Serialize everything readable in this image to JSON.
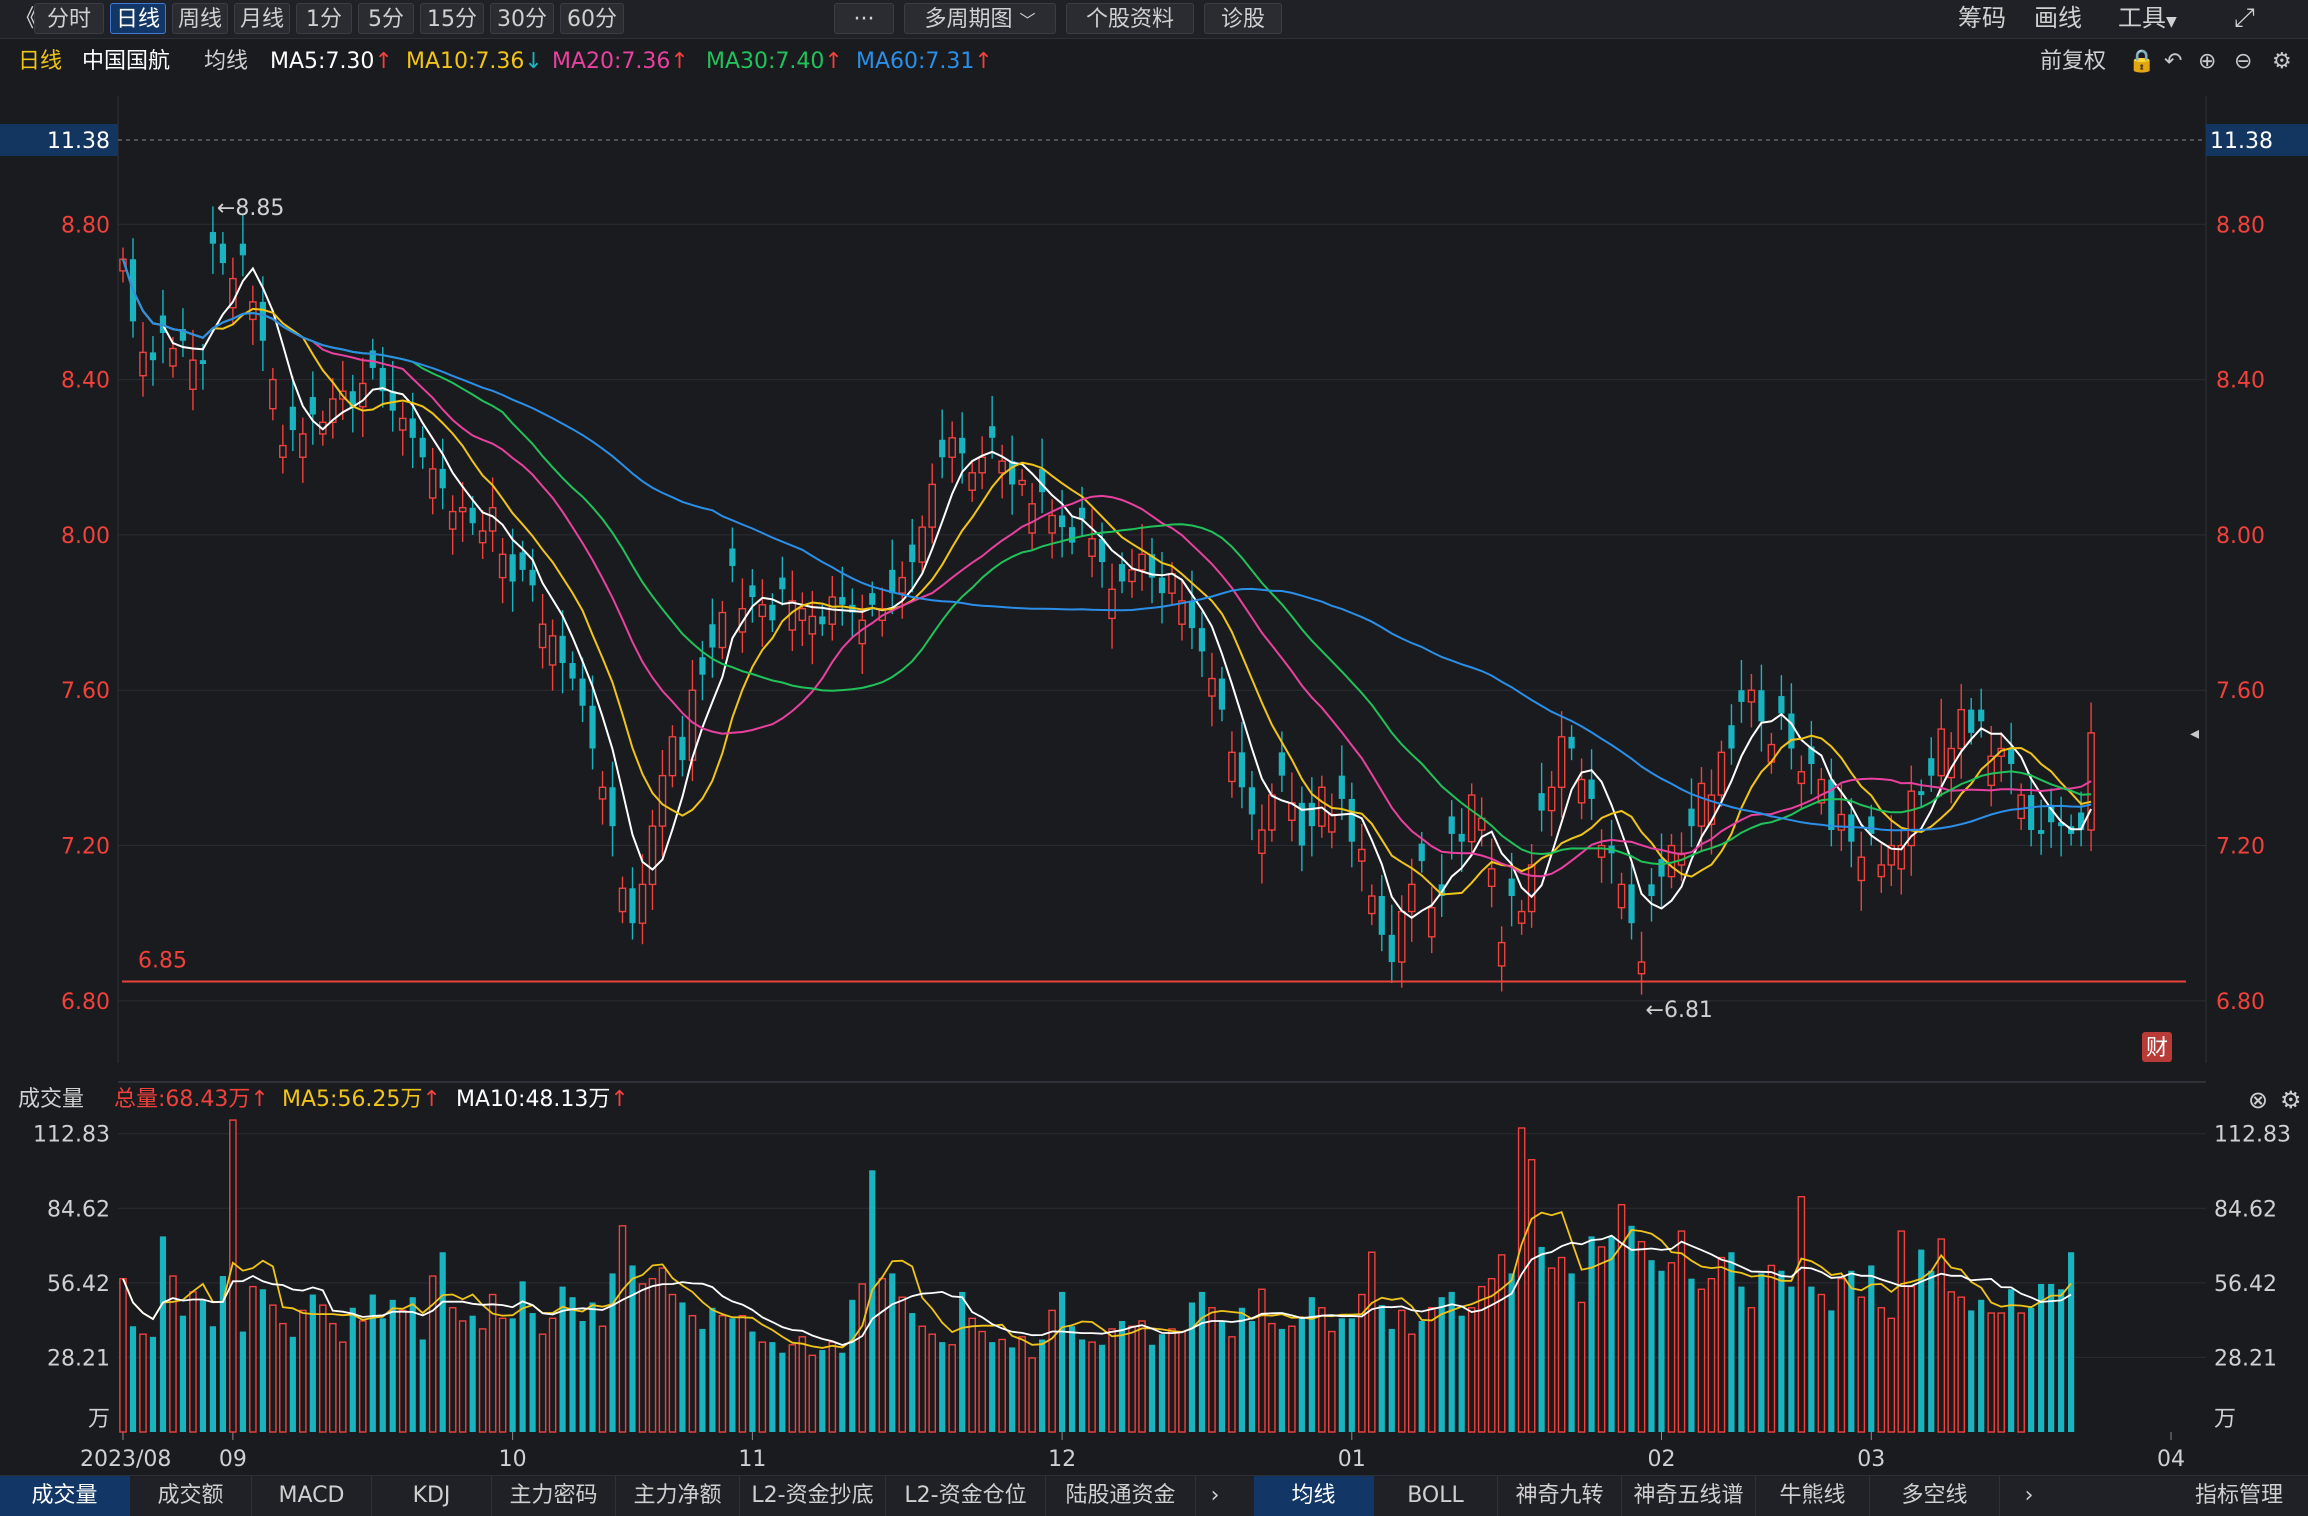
{
  "toolbar": {
    "back": "《",
    "periods": [
      "分时",
      "日线",
      "周线",
      "月线",
      "1分",
      "5分",
      "15分",
      "30分",
      "60分"
    ],
    "active_period": "日线",
    "more": "···",
    "multi": "多周期图",
    "profile": "个股资料",
    "diagnose": "诊股",
    "chips": "筹码",
    "draw": "画线",
    "tools": "工具"
  },
  "info": {
    "period": "日线",
    "stock": "中国国航",
    "ma_label": "均线",
    "ma5": "MA5:7.30",
    "ma10": "MA10:7.36",
    "ma20": "MA20:7.36",
    "ma30": "MA30:7.40",
    "ma60": "MA60:7.31",
    "adjust": "前复权"
  },
  "colors": {
    "up": "#f0413b",
    "down": "#19b4bf",
    "ma5": "#ffffff",
    "ma10": "#f0c419",
    "ma20": "#e8419f",
    "ma30": "#21c25a",
    "ma60": "#2b8fe8",
    "bg": "#1a1b1f"
  },
  "volume": {
    "label": "成交量",
    "total": "总量:68.43万",
    "ma5": "MA5:56.25万",
    "ma10": "MA10:48.13万",
    "unit": "万"
  },
  "annotations": {
    "high": "←8.85",
    "low": "←6.81",
    "support": "6.85",
    "top_price": "11.38",
    "fin_badge": "财"
  },
  "bottom_tabs": [
    "成交量",
    "成交额",
    "MACD",
    "KDJ",
    "主力密码",
    "主力净额",
    "L2-资金抄底",
    "L2-资金仓位",
    "陆股通资金"
  ],
  "bottom_tabs2": [
    "均线",
    "BOLL",
    "神奇九转",
    "神奇五线谱",
    "牛熊线",
    "多空线"
  ],
  "bottom_active": "成交量",
  "bottom_active2": "均线",
  "indicator_mgmt": "指标管理",
  "chart_data": {
    "type": "candlestick",
    "title": "中国国航 日线",
    "price_axis": {
      "ticks": [
        8.8,
        8.4,
        8.0,
        7.6,
        7.2,
        6.8
      ],
      "range": [
        6.64,
        9.12
      ],
      "top_label": 11.38
    },
    "volume_axis": {
      "ticks": [
        112.83,
        84.62,
        56.42,
        28.21
      ],
      "unit": "万",
      "range": [
        0,
        115
      ]
    },
    "x_labels": [
      "2023/08",
      "09",
      "10",
      "11",
      "12",
      "01",
      "02",
      "03",
      "04"
    ],
    "x_label_index": [
      0,
      11,
      39,
      63,
      94,
      123,
      154,
      175,
      205
    ],
    "support_line": 6.85,
    "extremes": {
      "high": 8.85,
      "low": 6.81
    },
    "ma_series": [
      "MA5",
      "MA10",
      "MA20",
      "MA30",
      "MA60"
    ],
    "ma_legend_values": [
      7.3,
      7.36,
      7.36,
      7.4,
      7.31
    ],
    "candle_count": 207,
    "closes": [
      8.71,
      8.55,
      8.47,
      8.45,
      8.52,
      8.48,
      8.5,
      8.45,
      8.44,
      8.75,
      8.7,
      8.66,
      8.72,
      8.6,
      8.5,
      8.4,
      8.23,
      8.27,
      8.26,
      8.31,
      8.29,
      8.35,
      8.37,
      8.33,
      8.39,
      8.43,
      8.37,
      8.32,
      8.3,
      8.25,
      8.2,
      8.17,
      8.12,
      8.06,
      8.07,
      8.03,
      8.01,
      8.07,
      7.95,
      7.88,
      7.91,
      7.87,
      7.77,
      7.74,
      7.67,
      7.63,
      7.56,
      7.45,
      7.35,
      7.25,
      7.09,
      7.0,
      7.1,
      7.25,
      7.38,
      7.48,
      7.42,
      7.6,
      7.64,
      7.71,
      7.8,
      7.92,
      7.81,
      7.84,
      7.82,
      7.78,
      7.86,
      7.83,
      7.81,
      7.79,
      7.77,
      7.84,
      7.82,
      7.8,
      7.78,
      7.82,
      7.81,
      7.85,
      7.89,
      7.93,
      8.02,
      8.13,
      8.2,
      8.25,
      8.21,
      8.16,
      8.2,
      8.25,
      8.19,
      8.13,
      8.14,
      8.08,
      8.11,
      8.05,
      8.02,
      7.98,
      8.04,
      7.99,
      7.93,
      7.86,
      7.88,
      7.91,
      7.95,
      7.89,
      7.85,
      7.9,
      7.83,
      7.76,
      7.7,
      7.63,
      7.55,
      7.44,
      7.35,
      7.28,
      7.24,
      7.33,
      7.38,
      7.31,
      7.2,
      7.25,
      7.35,
      7.28,
      7.32,
      7.21,
      7.19,
      7.07,
      6.97,
      6.9,
      7.03,
      7.1,
      7.16,
      7.04,
      7.07,
      7.23,
      7.21,
      7.33,
      7.27,
      7.14,
      6.95,
      7.07,
      7.03,
      7.15,
      7.29,
      7.35,
      7.48,
      7.45,
      7.37,
      7.32,
      7.2,
      7.18,
      7.1,
      7.0,
      6.9,
      7.07,
      7.12,
      7.2,
      7.18,
      7.25,
      7.36,
      7.33,
      7.44,
      7.45,
      7.57,
      7.6,
      7.52,
      7.46,
      7.54,
      7.45,
      7.39,
      7.41,
      7.37,
      7.24,
      7.28,
      7.21,
      7.17,
      7.23,
      7.15,
      7.2,
      7.2,
      7.34,
      7.33,
      7.38,
      7.5,
      7.45,
      7.55,
      7.49,
      7.52,
      7.43,
      7.45,
      7.41,
      7.33,
      7.24,
      7.23,
      7.26,
      7.25,
      7.23,
      7.24,
      7.49
    ],
    "volumes": [
      58,
      40,
      37,
      36,
      74,
      59,
      44,
      53,
      50,
      40,
      59,
      118,
      38,
      55,
      54,
      48,
      41,
      36,
      46,
      52,
      48,
      41,
      34,
      47,
      42,
      52,
      43,
      50,
      46,
      51,
      35,
      59,
      68,
      47,
      42,
      44,
      39,
      52,
      43,
      43,
      57,
      45,
      37,
      43,
      55,
      51,
      42,
      49,
      40,
      60,
      78,
      63,
      56,
      58,
      62,
      52,
      49,
      44,
      39,
      47,
      44,
      43,
      44,
      38,
      34,
      34,
      30,
      33,
      36,
      29,
      31,
      34,
      30,
      50,
      56,
      99,
      58,
      60,
      51,
      45,
      40,
      37,
      34,
      33,
      53,
      43,
      38,
      34,
      35,
      32,
      36,
      28,
      35,
      46,
      53,
      40,
      35,
      34,
      33,
      39,
      42,
      40,
      42,
      33,
      37,
      39,
      38,
      49,
      53,
      47,
      42,
      36,
      47,
      42,
      54,
      41,
      39,
      40,
      43,
      51,
      47,
      38,
      43,
      43,
      52,
      68,
      48,
      39,
      46,
      37,
      42,
      47,
      51,
      53,
      44,
      47,
      55,
      58,
      67,
      60,
      115,
      103,
      70,
      62,
      66,
      60,
      49,
      74,
      70,
      74,
      86,
      78,
      72,
      65,
      61,
      64,
      76,
      58,
      54,
      58,
      66,
      68,
      55,
      47,
      60,
      63,
      61,
      55,
      89,
      55,
      52,
      46,
      58,
      61,
      51,
      63,
      47,
      43,
      76,
      55,
      69,
      61,
      73,
      53,
      51,
      46,
      50,
      45,
      45,
      54,
      45,
      47,
      56,
      56,
      54,
      68
    ],
    "up_flags": "1010010100010101101011101000100101101110001100001010111101001010100111010010101011010110101101000101011001100101001101001100110011010001111011011010101010011011100101001010101011110011100110100000011",
    "ma5_axis_note": ""
  }
}
